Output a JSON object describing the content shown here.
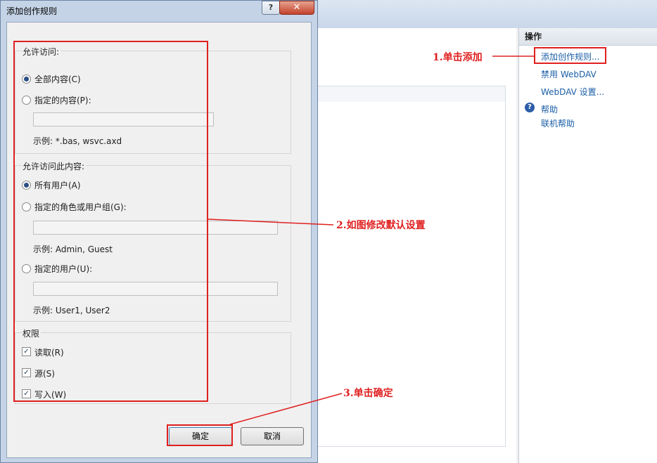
{
  "dialog": {
    "title": "添加创作规则",
    "help_label": "?",
    "close_label": "✕",
    "allow_access_group": {
      "label": "允许访问:",
      "all_content": "全部内容(C)",
      "specified_content": "指定的内容(P):",
      "specified_content_value": "",
      "example": "示例: *.bas, wsvc.axd"
    },
    "allow_content_group": {
      "label": "允许访问此内容:",
      "all_users": "所有用户(A)",
      "specified_roles": "指定的角色或用户组(G):",
      "roles_value": "",
      "roles_example": "示例: Admin, Guest",
      "specified_users": "指定的用户(U):",
      "users_value": "",
      "users_example": "示例: User1, User2"
    },
    "permissions_group": {
      "label": "权限",
      "read": "读取(R)",
      "source": "源(S)",
      "write": "写入(W)",
      "check_mark": "✓"
    },
    "ok_label": "确定",
    "cancel_label": "取消"
  },
  "actions_pane": {
    "header": "操作",
    "add_rule": "添加创作规则...",
    "disable_webdav": "禁用 WebDAV",
    "webdav_settings": "WebDAV 设置...",
    "help_icon_glyph": "?",
    "help": "帮助",
    "online_help": "联机帮助"
  },
  "annotations": {
    "step1": "1.单击添加",
    "step2": "2.如图修改默认设置",
    "step3": "3.单击确定",
    "color": "#e02020"
  }
}
